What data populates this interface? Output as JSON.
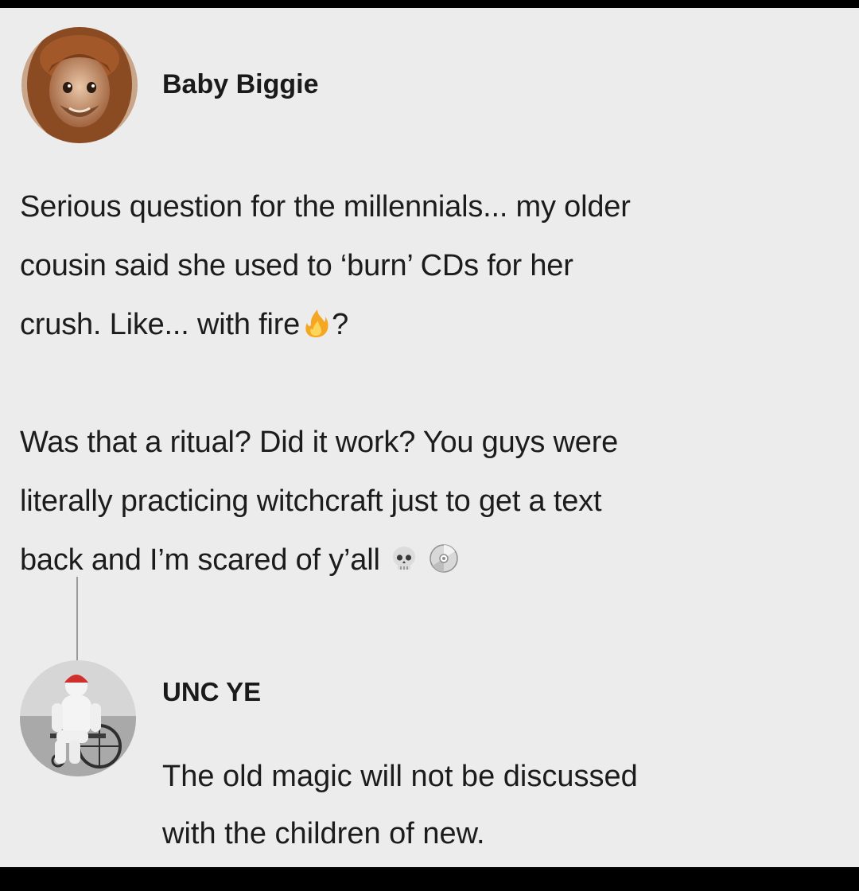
{
  "post": {
    "author": "Baby Biggie",
    "lines": [
      "Serious question for the millennials... my older",
      "cousin said she used to ‘burn’ CDs for her",
      "crush. Like... with fire",
      "Was that a ritual? Did it work? You guys were",
      "literally practicing witchcraft just to get a text",
      "back and I’m scared of y’all"
    ],
    "line3_suffix": "?",
    "icons": [
      "fire-emoji",
      "skull-emoji",
      "cd-emoji"
    ]
  },
  "reply": {
    "author": "UNC YE",
    "lines": [
      "The old magic will not be discussed",
      "with the children of new."
    ]
  },
  "colors": {
    "background": "#ececec",
    "text": "#1c1c1c",
    "thread_line": "#9a9a9a"
  }
}
